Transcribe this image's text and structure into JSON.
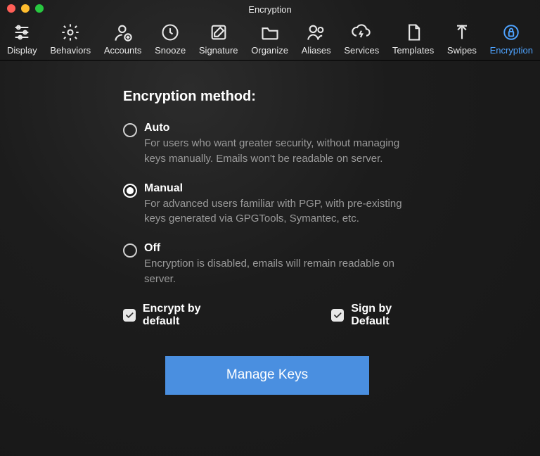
{
  "window": {
    "title": "Encryption"
  },
  "toolbar": {
    "items": [
      {
        "id": "display",
        "label": "Display",
        "icon": "sliders-icon"
      },
      {
        "id": "behaviors",
        "label": "Behaviors",
        "icon": "gear-icon"
      },
      {
        "id": "accounts",
        "label": "Accounts",
        "icon": "person-plus-icon"
      },
      {
        "id": "snooze",
        "label": "Snooze",
        "icon": "clock-icon"
      },
      {
        "id": "signature",
        "label": "Signature",
        "icon": "pencil-square-icon"
      },
      {
        "id": "organize",
        "label": "Organize",
        "icon": "folder-icon"
      },
      {
        "id": "aliases",
        "label": "Aliases",
        "icon": "people-icon"
      },
      {
        "id": "services",
        "label": "Services",
        "icon": "cloud-lightning-icon"
      },
      {
        "id": "templates",
        "label": "Templates",
        "icon": "document-icon"
      },
      {
        "id": "swipes",
        "label": "Swipes",
        "icon": "swipe-icon"
      },
      {
        "id": "encryption",
        "label": "Encryption",
        "icon": "lock-icon",
        "active": true
      }
    ]
  },
  "section_title": "Encryption method:",
  "options": [
    {
      "id": "auto",
      "label": "Auto",
      "desc": "For users who want greater security, without managing keys manually. Emails won't be readable on server.",
      "selected": false
    },
    {
      "id": "manual",
      "label": "Manual",
      "desc": "For advanced users familiar with PGP, with pre-existing keys generated via GPGTools, Symantec, etc.",
      "selected": true
    },
    {
      "id": "off",
      "label": "Off",
      "desc": "Encryption is disabled, emails will remain readable on server.",
      "selected": false
    }
  ],
  "checks": {
    "encrypt_default": {
      "label": "Encrypt by default",
      "checked": true
    },
    "sign_default": {
      "label": "Sign by Default",
      "checked": true
    }
  },
  "manage_button": "Manage Keys"
}
